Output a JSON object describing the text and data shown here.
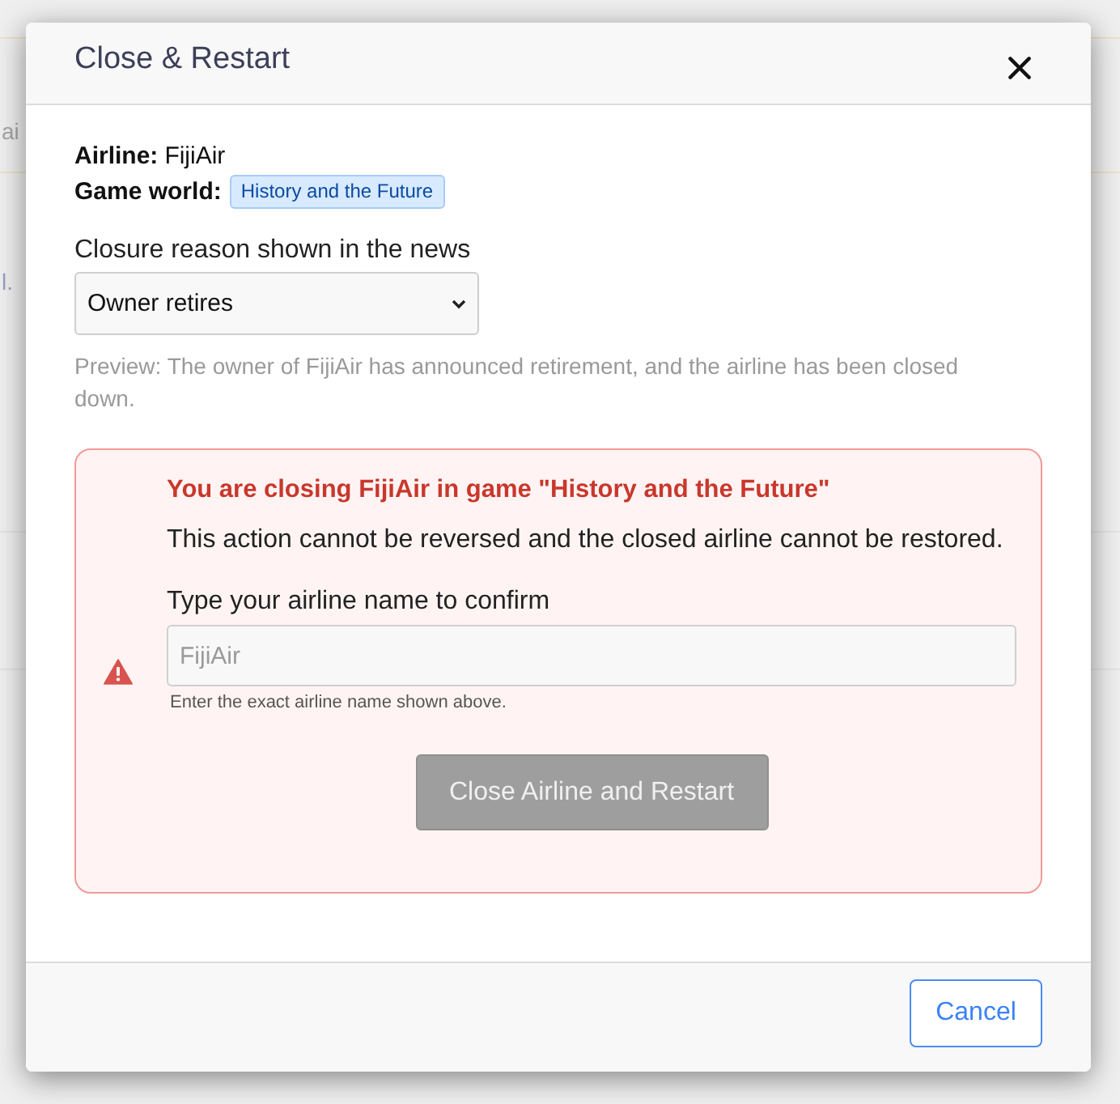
{
  "background": {
    "texts": [
      "ai",
      "l."
    ]
  },
  "dialog": {
    "title": "Close & Restart"
  },
  "details": [
    {
      "label": "Airline:",
      "value": "FijiAir",
      "kind": "text"
    },
    {
      "label": "Game world:",
      "value": "History and the Future",
      "kind": "badge"
    }
  ],
  "reason": {
    "label": "Closure reason shown in the news",
    "value": "Owner retires"
  },
  "preview": "Preview: The owner of FijiAir has announced retirement, and the airline has been closed down.",
  "warning": {
    "title": "You are closing FijiAir in game \"History and the Future\"",
    "text": "This action cannot be reversed and the closed airline cannot be restored.",
    "confirm_label": "Type your airline name to confirm",
    "confirm_field": {
      "placeholder": "FijiAir"
    },
    "hint": "Enter the exact airline name shown above.",
    "button": {
      "label": "Close Airline and Restart",
      "disabled": true
    }
  },
  "footer": {
    "buttons": [
      {
        "label": "Cancel",
        "kind": "outline"
      }
    ]
  }
}
